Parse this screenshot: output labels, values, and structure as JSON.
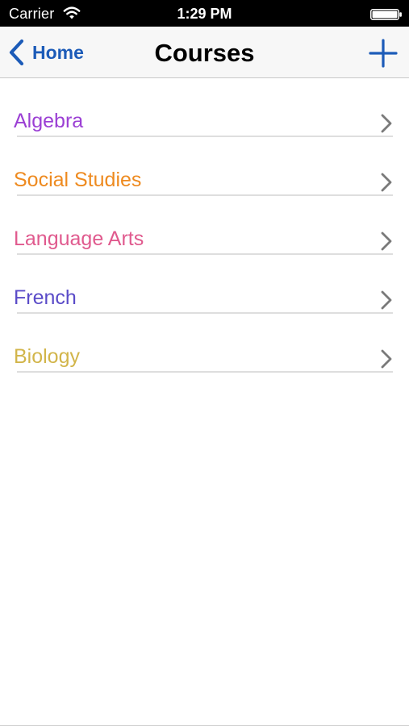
{
  "status_bar": {
    "carrier": "Carrier",
    "time": "1:29 PM",
    "wifi_icon": "wifi-icon",
    "battery_icon": "battery-icon"
  },
  "nav_bar": {
    "back_label": "Home",
    "back_icon": "chevron-left-icon",
    "title": "Courses",
    "add_icon": "plus-icon",
    "accent_color": "#1c5bb8"
  },
  "courses": [
    {
      "name": "Algebra",
      "color": "#9b3fd4"
    },
    {
      "name": "Social Studies",
      "color": "#ee8a1f"
    },
    {
      "name": "Language Arts",
      "color": "#e05a8e"
    },
    {
      "name": "French",
      "color": "#5a4bc8"
    },
    {
      "name": "Biology",
      "color": "#d2b54a"
    }
  ],
  "row_chevron_icon": "chevron-right-icon"
}
